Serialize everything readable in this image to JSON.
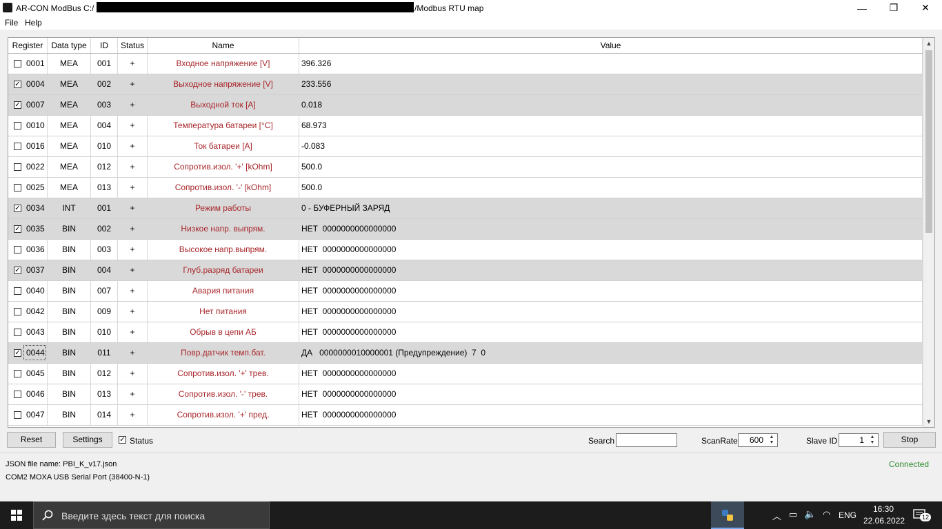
{
  "window": {
    "title_prefix": "AR-CON ModBus   C:/",
    "title_suffix": "/Modbus RTU map",
    "minimize_glyph": "—",
    "restore_glyph": "❐",
    "close_glyph": "✕"
  },
  "menu": {
    "file": "File",
    "help": "Help"
  },
  "table": {
    "headers": {
      "register": "Register",
      "data_type": "Data type",
      "id": "ID",
      "status": "Status",
      "name": "Name",
      "value": "Value"
    },
    "rows": [
      {
        "register": "0001",
        "type": "MEA",
        "id": "001",
        "status": "+",
        "name": "Входное напряжение [V]",
        "value": "396.326",
        "checked": false
      },
      {
        "register": "0004",
        "type": "MEA",
        "id": "002",
        "status": "+",
        "name": "Выходное напряжение [V]",
        "value": "233.556",
        "checked": true
      },
      {
        "register": "0007",
        "type": "MEA",
        "id": "003",
        "status": "+",
        "name": "Выходной ток [A]",
        "value": "0.018",
        "checked": true
      },
      {
        "register": "0010",
        "type": "MEA",
        "id": "004",
        "status": "+",
        "name": "Температура батареи [°C]",
        "value": "68.973",
        "checked": false
      },
      {
        "register": "0016",
        "type": "MEA",
        "id": "010",
        "status": "+",
        "name": "Ток батареи [A]",
        "value": "-0.083",
        "checked": false
      },
      {
        "register": "0022",
        "type": "MEA",
        "id": "012",
        "status": "+",
        "name": "Сопротив.изол. '+' [kOhm]",
        "value": "500.0",
        "checked": false
      },
      {
        "register": "0025",
        "type": "MEA",
        "id": "013",
        "status": "+",
        "name": "Сопротив.изол. '-' [kOhm]",
        "value": "500.0",
        "checked": false
      },
      {
        "register": "0034",
        "type": "INT",
        "id": "001",
        "status": "+",
        "name": "Режим работы",
        "value": "0 - БУФЕРНЫЙ ЗАРЯД",
        "checked": true
      },
      {
        "register": "0035",
        "type": "BIN",
        "id": "002",
        "status": "+",
        "name": "Низкое напр. выпрям.",
        "value": "НЕТ  0000000000000000",
        "checked": true
      },
      {
        "register": "0036",
        "type": "BIN",
        "id": "003",
        "status": "+",
        "name": "Высокое напр.выпрям.",
        "value": "НЕТ  0000000000000000",
        "checked": false
      },
      {
        "register": "0037",
        "type": "BIN",
        "id": "004",
        "status": "+",
        "name": "Глуб.разряд батареи",
        "value": "НЕТ  0000000000000000",
        "checked": true
      },
      {
        "register": "0040",
        "type": "BIN",
        "id": "007",
        "status": "+",
        "name": "Авария питания",
        "value": "НЕТ  0000000000000000",
        "checked": false
      },
      {
        "register": "0042",
        "type": "BIN",
        "id": "009",
        "status": "+",
        "name": "Нет питания",
        "value": "НЕТ  0000000000000000",
        "checked": false
      },
      {
        "register": "0043",
        "type": "BIN",
        "id": "010",
        "status": "+",
        "name": "Обрыв в цепи АБ",
        "value": "НЕТ  0000000000000000",
        "checked": false
      },
      {
        "register": "0044",
        "type": "BIN",
        "id": "011",
        "status": "+",
        "name": "Повр.датчик темп.бат.",
        "value": "ДА   0000000010000001 (Предупреждение)  7  0",
        "checked": true
      },
      {
        "register": "0045",
        "type": "BIN",
        "id": "012",
        "status": "+",
        "name": "Сопротив.изол. '+' трев.",
        "value": "НЕТ  0000000000000000",
        "checked": false
      },
      {
        "register": "0046",
        "type": "BIN",
        "id": "013",
        "status": "+",
        "name": "Сопротив.изол. '-' трев.",
        "value": "НЕТ  0000000000000000",
        "checked": false
      },
      {
        "register": "0047",
        "type": "BIN",
        "id": "014",
        "status": "+",
        "name": "Сопротив.изол. '+' пред.",
        "value": "НЕТ  0000000000000000",
        "checked": false
      }
    ]
  },
  "controls": {
    "reset_label": "Reset",
    "settings_label": "Settings",
    "status_checkbox_label": "Status",
    "status_checked": true,
    "search_label": "Search",
    "search_value": "",
    "scanrate_label": "ScanRate",
    "scanrate_value": "600",
    "slave_id_label": "Slave ID",
    "slave_id_value": "1",
    "stop_label": "Stop"
  },
  "status_bar": {
    "json_file": "JSON file name: PBI_K_v17.json",
    "port": "COM2 MOXA USB Serial Port (38400-N-1)",
    "connection": "Connected",
    "connection_color": "#2e8b2e"
  },
  "taskbar": {
    "search_placeholder": "Введите здесь текст для поиска",
    "language": "ENG",
    "time": "16:30",
    "date": "22.06.2022",
    "notifications": "12"
  },
  "icons": [
    "app-icon",
    "windows-start-icon",
    "search-icon",
    "python-app-icon",
    "chevron-up-icon",
    "battery-icon",
    "speaker-icon",
    "wifi-icon",
    "notification-icon"
  ]
}
